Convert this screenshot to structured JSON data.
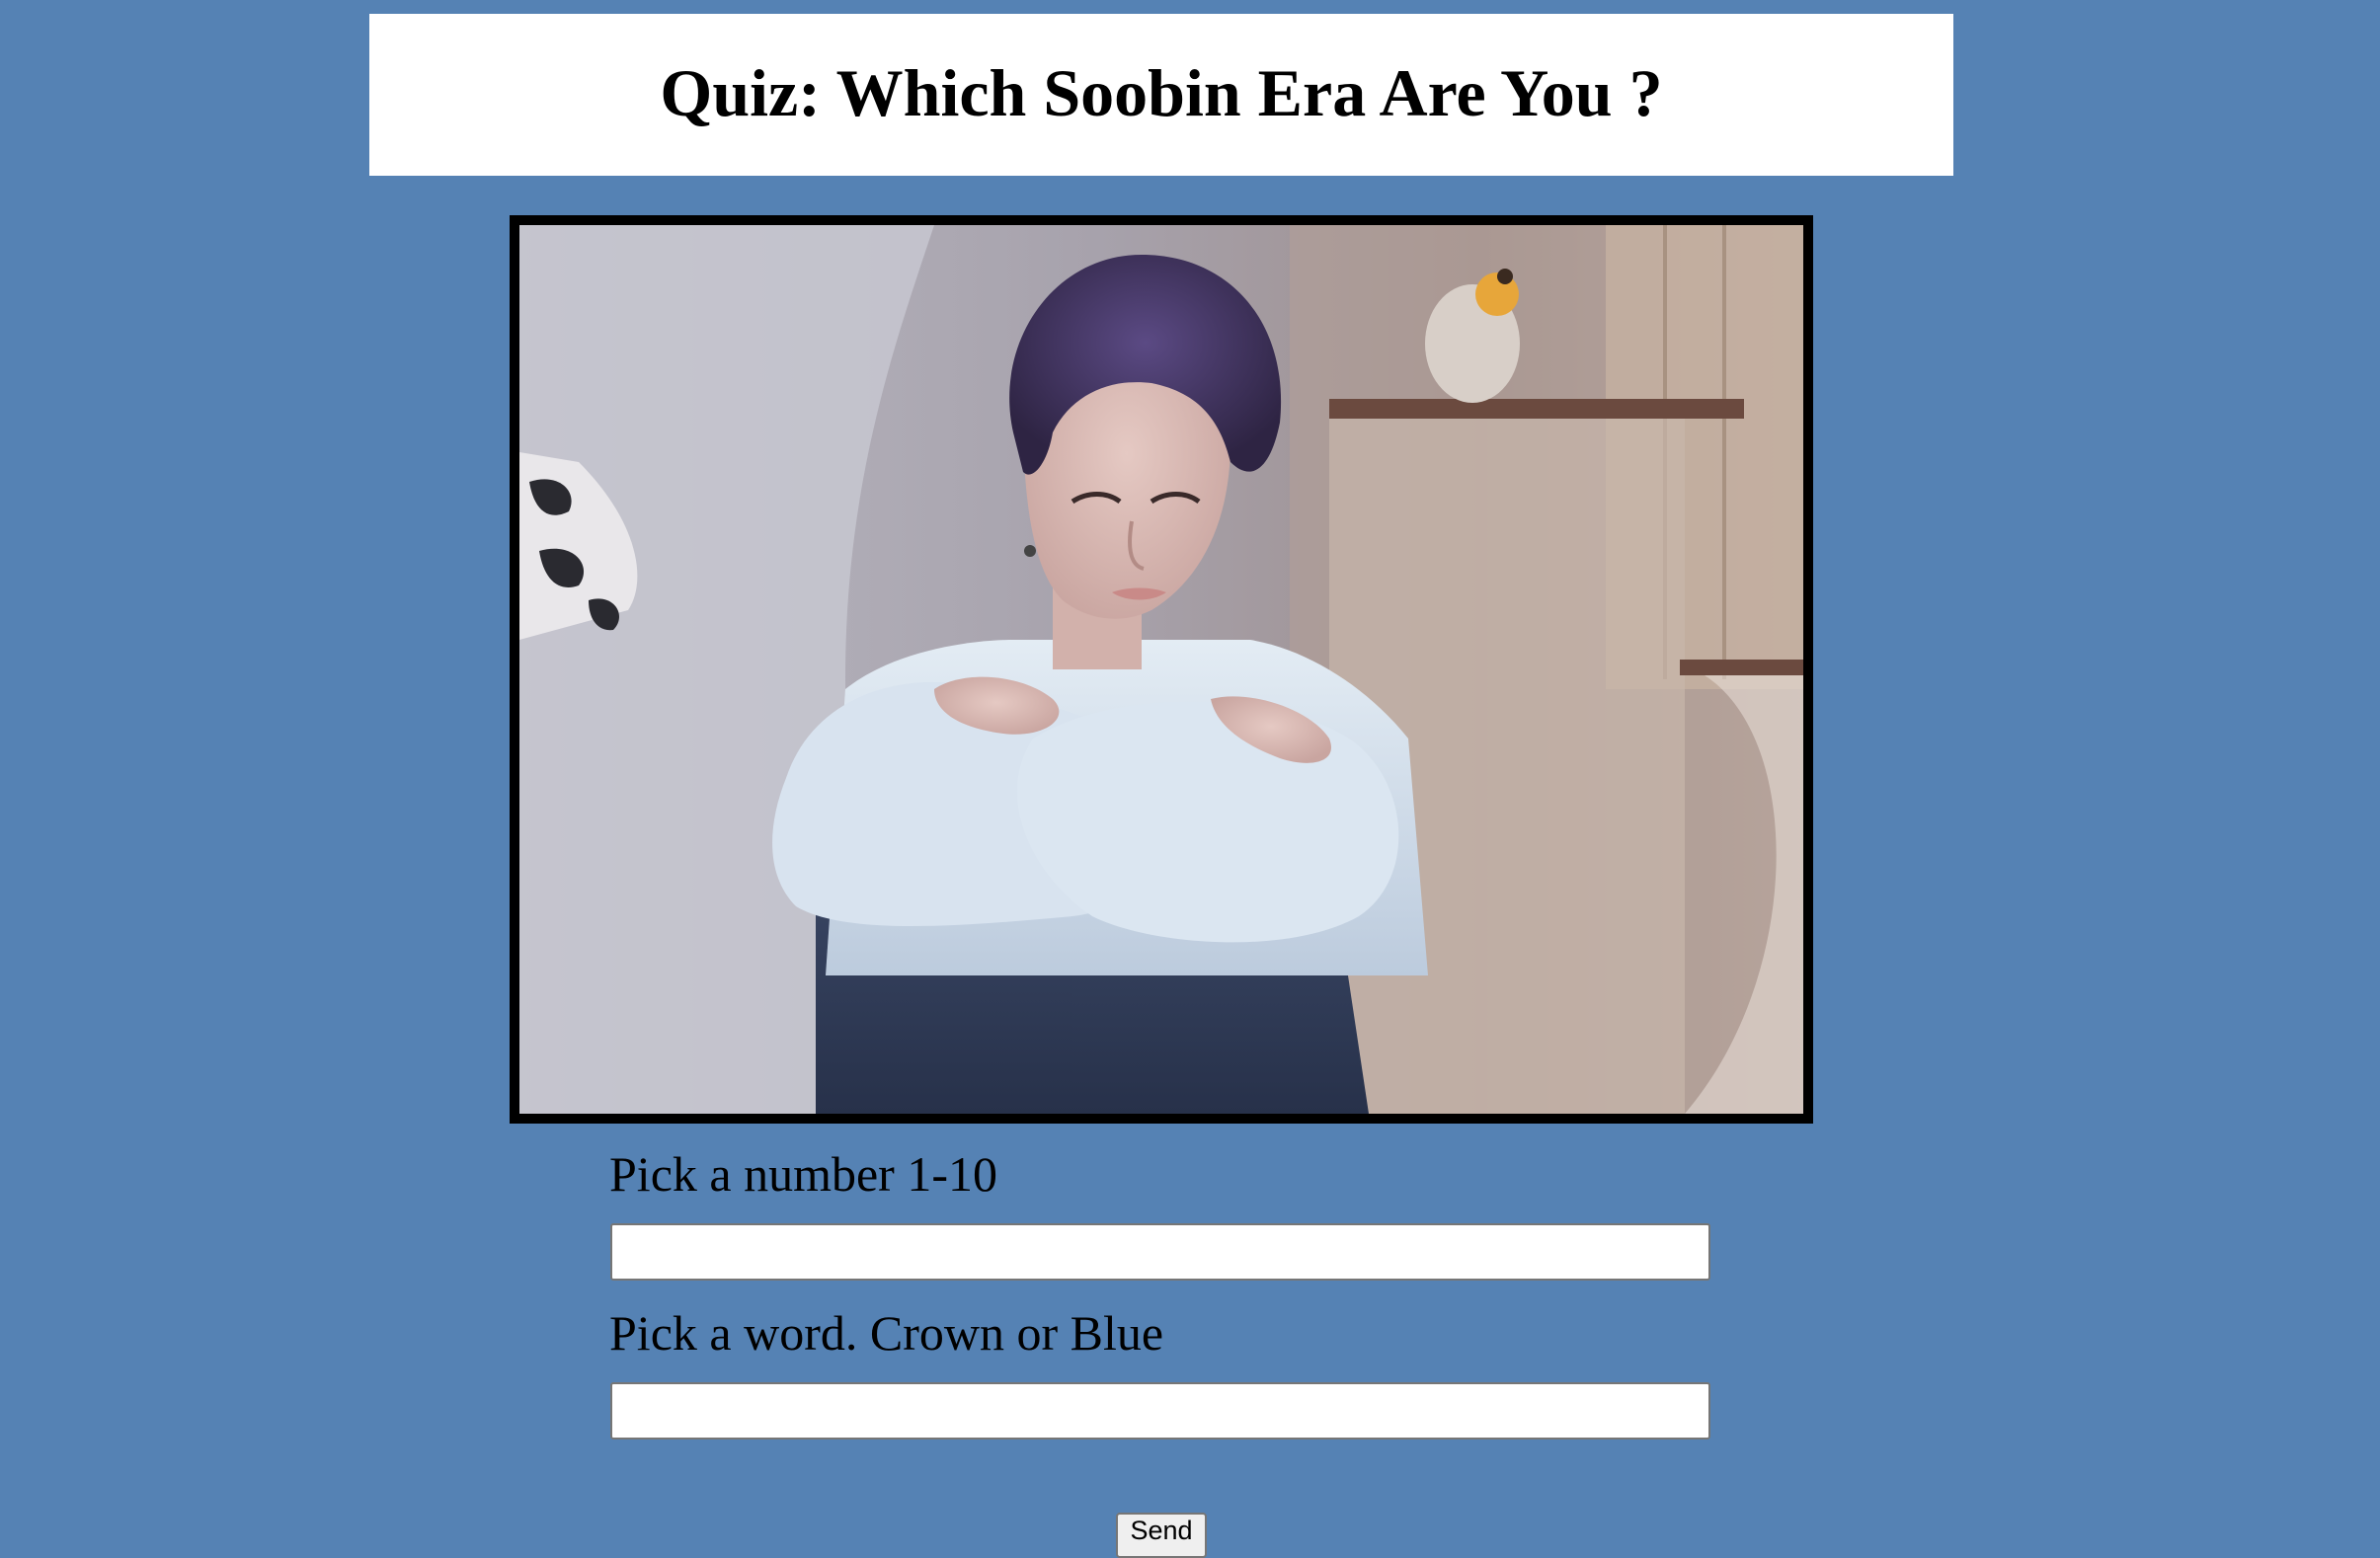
{
  "page": {
    "title": "Quiz: Which Soobin Era Are You ?",
    "background_color": "#5582b4"
  },
  "photo": {
    "subject": "person-photo",
    "border_color": "#000000"
  },
  "form": {
    "question_1": {
      "label": "Pick a number 1-10",
      "value": "",
      "placeholder": ""
    },
    "question_2": {
      "label": "Pick a word. Crown or Blue",
      "value": "",
      "placeholder": ""
    },
    "submit_label": "Send"
  }
}
